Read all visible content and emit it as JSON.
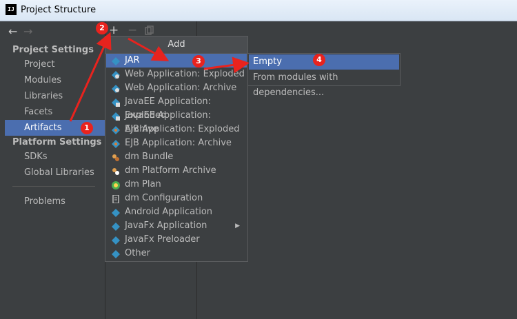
{
  "window": {
    "icon_text": "IJ",
    "title": "Project Structure"
  },
  "sidebar": {
    "back_icon": "arrow-left-icon",
    "forward_icon": "arrow-right-icon",
    "project_settings_header": "Project Settings",
    "project_settings_items": [
      "Project",
      "Modules",
      "Libraries",
      "Facets",
      "Artifacts"
    ],
    "platform_settings_header": "Platform Settings",
    "platform_settings_items": [
      "SDKs",
      "Global Libraries"
    ],
    "other_items": [
      "Problems"
    ],
    "selected": "Artifacts"
  },
  "toolbar": {
    "add": "+",
    "remove": "−",
    "copy": "copy-icon"
  },
  "add_menu": {
    "title": "Add",
    "items": [
      {
        "label": "JAR",
        "icon": "jar-diamond-icon",
        "has_submenu": true,
        "highlighted": true
      },
      {
        "label": "Web Application: Exploded",
        "icon": "web-app-icon"
      },
      {
        "label": "Web Application: Archive",
        "icon": "web-app-icon"
      },
      {
        "label": "JavaEE Application: Exploded",
        "icon": "javaee-icon"
      },
      {
        "label": "JavaEE Application: Archive",
        "icon": "javaee-icon"
      },
      {
        "label": "EJB Application: Exploded",
        "icon": "ejb-icon"
      },
      {
        "label": "EJB Application: Archive",
        "icon": "ejb-icon"
      },
      {
        "label": "dm Bundle",
        "icon": "dm-bundle-icon"
      },
      {
        "label": "dm Platform Archive",
        "icon": "dm-platform-icon"
      },
      {
        "label": "dm Plan",
        "icon": "dm-plan-icon"
      },
      {
        "label": "dm Configuration",
        "icon": "dm-config-icon"
      },
      {
        "label": "Android Application",
        "icon": "android-icon"
      },
      {
        "label": "JavaFx Application",
        "icon": "javafx-icon",
        "has_submenu": true
      },
      {
        "label": "JavaFx Preloader",
        "icon": "javafx-icon"
      },
      {
        "label": "Other",
        "icon": "other-icon"
      }
    ]
  },
  "jar_submenu": {
    "items": [
      "Empty",
      "From modules with dependencies..."
    ],
    "highlighted": "Empty"
  },
  "annotations": {
    "badges": [
      "1",
      "2",
      "3",
      "4"
    ],
    "color": "#e8231e"
  },
  "colors": {
    "background": "#3c3f41",
    "selection": "#4b6eaf",
    "icon_blue": "#3592c4"
  }
}
